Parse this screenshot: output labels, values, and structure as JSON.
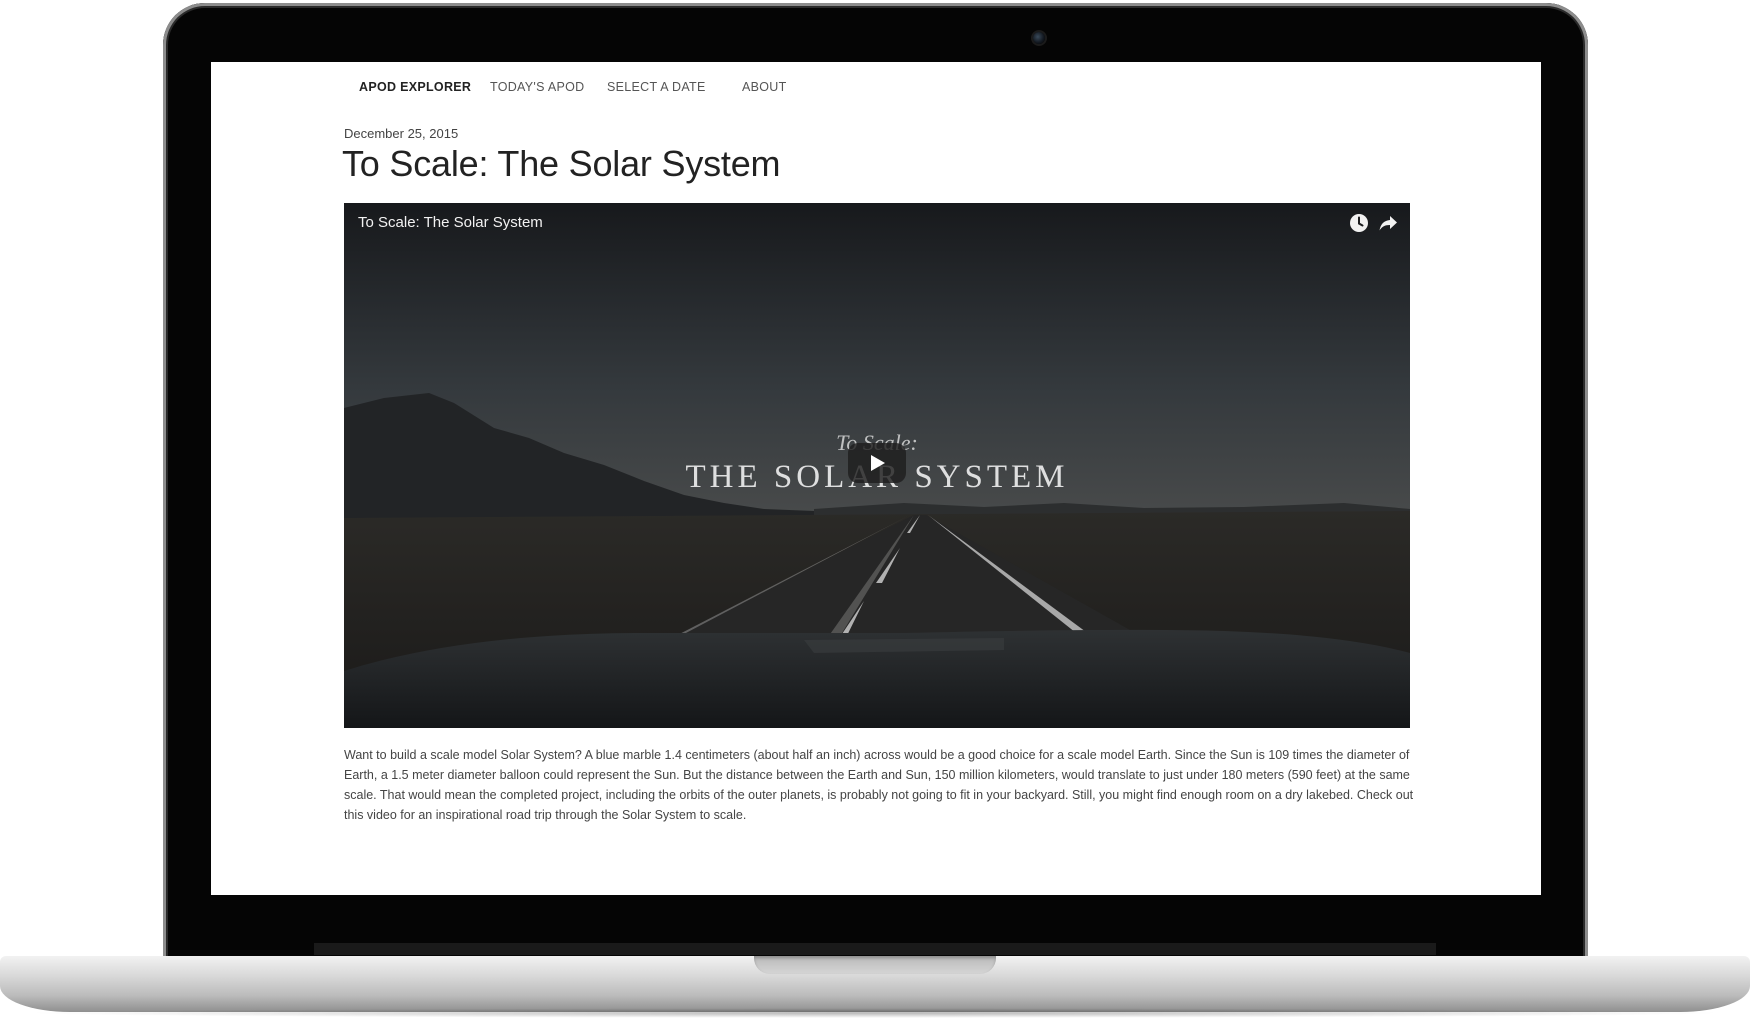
{
  "nav": {
    "brand": "APOD EXPLORER",
    "items": [
      "TODAY'S APOD",
      "SELECT A DATE",
      "ABOUT"
    ]
  },
  "post": {
    "date": "December 25, 2015",
    "title": "To Scale: The Solar System",
    "description": "Want to build a scale model Solar System? A blue marble 1.4 centimeters (about half an inch) across would be a good choice for a scale model Earth. Since the Sun is 109 times the diameter of Earth, a 1.5 meter diameter balloon could represent the Sun. But the distance between the Earth and Sun, 150 million kilometers, would translate to just under 180 meters (590 feet) at the same scale. That would mean the completed project, including the orbits of the outer planets, is probably not going to fit in your backyard. Still, you might find enough room on a dry lakebed. Check out this video for an inspirational road trip through the Solar System to scale."
  },
  "video": {
    "title": "To Scale: The Solar System",
    "overlay_small": "To Scale:",
    "overlay_big": "THE SOLAR SYSTEM",
    "icons": [
      "clock-icon",
      "share-icon",
      "play-icon"
    ]
  }
}
